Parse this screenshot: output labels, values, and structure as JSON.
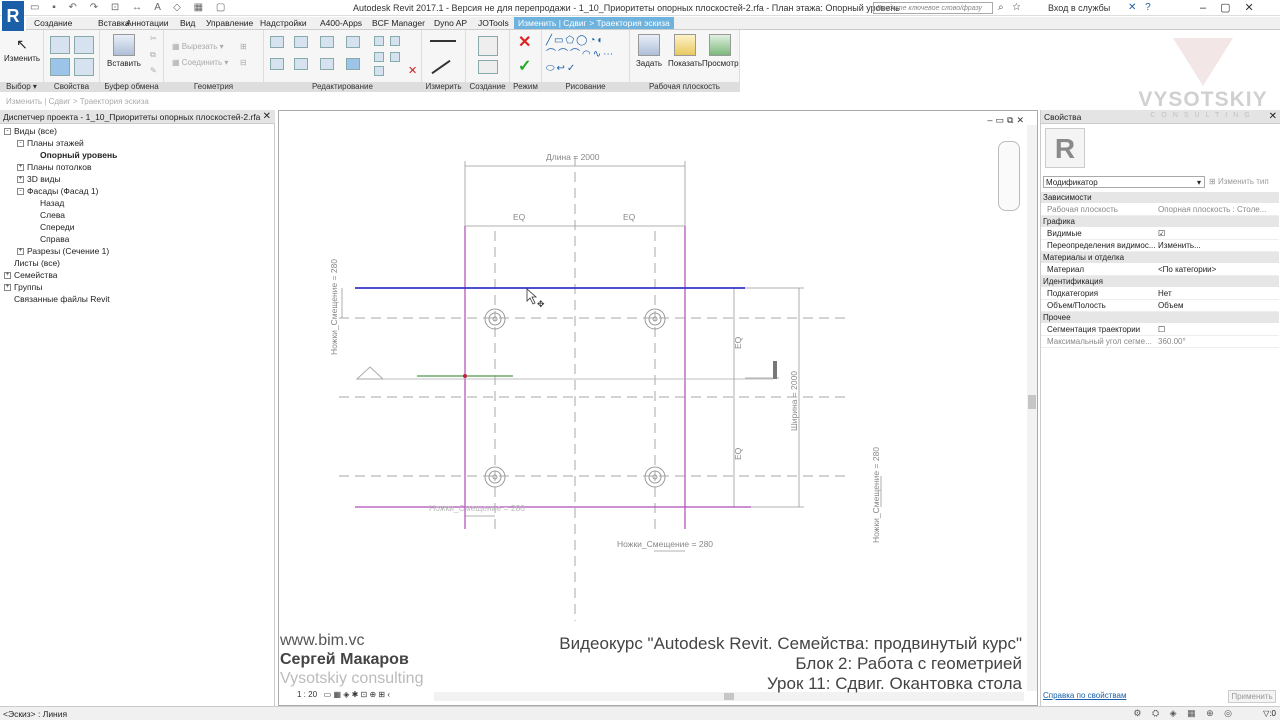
{
  "title_bar": {
    "app_title": "Autodesk Revit 2017.1 - Версия не для перепродажи -    1_10_Приоритеты опорных плоскостей-2.rfa - План этажа: Опорный уровень",
    "search_placeholder": "Введите ключевое слово/фразу",
    "sign_in": "Вход в службы",
    "logo": "R"
  },
  "tabs": [
    "Создание",
    "Вставка",
    "Аннотации",
    "Вид",
    "Управление",
    "Надстройки",
    "A400-Apps",
    "BCF Manager",
    "Dyno AP",
    "JOTools",
    "Изменить | Сдвиг > Траектория эскиза"
  ],
  "active_tab": "Изменить | Сдвиг > Траектория эскиза",
  "ribbon": {
    "modify_label": "Изменить",
    "select_label": "Выбор",
    "properties_label": "Свойства",
    "paste_label": "Вставить",
    "clipboard_label": "Буфер обмена",
    "cut_label": "Вырезать",
    "join_label": "Соединить",
    "geometry_label": "Геометрия",
    "modify_panel_label": "Редактирование",
    "measure_label": "Измерить",
    "create_label": "Создание",
    "mode_label": "Режим",
    "draw_label": "Рисование",
    "set_label": "Задать",
    "show_label": "Показать",
    "viewer_label": "Просмотр",
    "workplane_label": "Рабочая плоскость"
  },
  "context_bar": "Изменить | Сдвиг > Траектория эскиза",
  "project_browser": {
    "title": "Диспетчер проекта - 1_10_Приоритеты опорных плоскостей-2.rfa",
    "nodes": [
      {
        "label": "Виды (все)",
        "level": 0,
        "expander": "-"
      },
      {
        "label": "Планы этажей",
        "level": 1,
        "expander": "-"
      },
      {
        "label": "Опорный уровень",
        "level": 2,
        "expander": "",
        "bold": true
      },
      {
        "label": "Планы потолков",
        "level": 1,
        "expander": "+"
      },
      {
        "label": "3D виды",
        "level": 1,
        "expander": "+"
      },
      {
        "label": "Фасады (Фасад 1)",
        "level": 1,
        "expander": "-"
      },
      {
        "label": "Назад",
        "level": 2,
        "expander": ""
      },
      {
        "label": "Слева",
        "level": 2,
        "expander": ""
      },
      {
        "label": "Спереди",
        "level": 2,
        "expander": ""
      },
      {
        "label": "Справа",
        "level": 2,
        "expander": ""
      },
      {
        "label": "Разрезы (Сечение 1)",
        "level": 1,
        "expander": "+"
      },
      {
        "label": "Листы (все)",
        "level": 0,
        "expander": ""
      },
      {
        "label": "Семейства",
        "level": 0,
        "expander": "+"
      },
      {
        "label": "Группы",
        "level": 0,
        "expander": "+"
      },
      {
        "label": "Связанные файлы Revit",
        "level": 0,
        "expander": ""
      }
    ]
  },
  "canvas": {
    "dim_length": "Длина = 2000",
    "eq": "EQ",
    "dim_offset": "Ножки_Смещение = 280",
    "dim_width": "Ширина = 2000",
    "scale": "1 : 20"
  },
  "overlay": {
    "url": "www.bim.vc",
    "author": "Сергей Макаров",
    "company": "Vysotskiy consulting",
    "course": "Видеокурс \"Autodesk Revit. Семейства: продвинутый курс\"",
    "block": "Блок 2: Работа с геометрией",
    "lesson": "Урок 11: Сдвиг. Окантовка стола"
  },
  "watermark": {
    "brand": "VYSOTSKIY",
    "sub": "CONSULTING"
  },
  "properties": {
    "title": "Свойства",
    "type_selector": "Модификатор",
    "edit_type": "Изменить тип",
    "groups": [
      {
        "category": "Зависимости",
        "rows": [
          {
            "name": "Рабочая плоскость",
            "value": "Опорная плоскость : Столе...",
            "grey": true
          }
        ]
      },
      {
        "category": "Графика",
        "rows": [
          {
            "name": "Видимые",
            "value": "☑"
          },
          {
            "name": "Переопределения видимос...",
            "value": "Изменить..."
          }
        ]
      },
      {
        "category": "Материалы и отделка",
        "rows": [
          {
            "name": "Материал",
            "value": "<По категории>"
          }
        ]
      },
      {
        "category": "Идентификация",
        "rows": [
          {
            "name": "Подкатегория",
            "value": "Нет"
          },
          {
            "name": "Объем/Полость",
            "value": "Объем"
          }
        ]
      },
      {
        "category": "Прочее",
        "rows": [
          {
            "name": "Сегментация траектории",
            "value": "☐"
          },
          {
            "name": "Максимальный угол сегме...",
            "value": "360.00°",
            "grey": true
          }
        ]
      }
    ],
    "help_link": "Справка по свойствам",
    "apply": "Применить"
  },
  "status_bar": {
    "left": "<Эскиз> : Линия",
    "filter": "0"
  }
}
